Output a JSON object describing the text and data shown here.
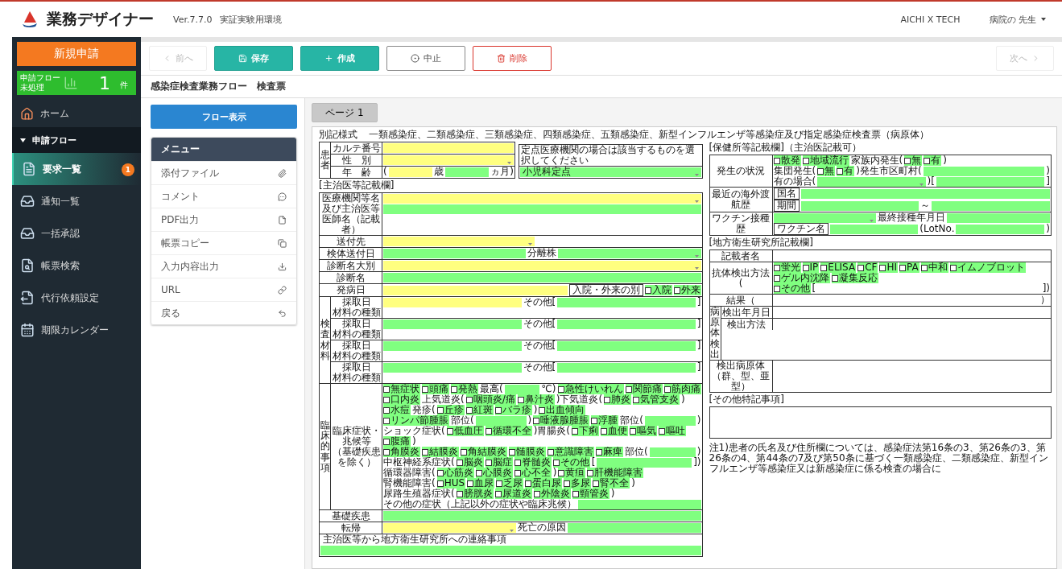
{
  "header": {
    "app_name": "業務デザイナー",
    "version": "Ver.7.7.0",
    "environment": "実証実験用環境",
    "org": "AICHI X TECH",
    "user": "病院の 先生"
  },
  "sidebar": {
    "new_button": "新規申請",
    "flow_panel": {
      "title": "申請フロー",
      "status": "未処理",
      "count": "1",
      "unit": "件"
    },
    "items": [
      {
        "label": "ホーム",
        "selected": false
      }
    ],
    "section": {
      "label": "申請フロー",
      "expanded": true
    },
    "sub_items": [
      {
        "label": "要求一覧",
        "selected": true,
        "badge": "1"
      },
      {
        "label": "通知一覧",
        "selected": false
      },
      {
        "label": "一括承認",
        "selected": false
      },
      {
        "label": "帳票検索",
        "selected": false
      },
      {
        "label": "代行依頼設定",
        "selected": false
      },
      {
        "label": "期限カレンダー",
        "selected": false
      }
    ]
  },
  "toolbar": {
    "prev": {
      "label": "前へ",
      "disabled": true
    },
    "buttons": [
      {
        "kind": "save",
        "label": "保存"
      },
      {
        "kind": "create",
        "label": "作成"
      },
      {
        "kind": "cancel",
        "label": "中止"
      },
      {
        "kind": "delete",
        "label": "削除"
      }
    ],
    "next": {
      "label": "次へ",
      "disabled": true
    }
  },
  "page_title": "感染症検査業務フロー　検査票",
  "flow_button": "フロー表示",
  "menu": {
    "title": "メニュー",
    "items": [
      "添付ファイル",
      "コメント",
      "PDF出力",
      "帳票コピー",
      "入力内容出力",
      "URL",
      "戻る"
    ]
  },
  "tabs": [
    {
      "label": "ページ 1",
      "selected": true
    }
  ],
  "form": {
    "form_no": "別記様式",
    "title": "一類感染症、二類感染症、三類感染症、四類感染症、五類感染症、新型インフルエンザ等感染症及び指定感染症検査票（病原体）",
    "left": [
      {
        "kind": "table",
        "rows": [
          {
            "kind": "group",
            "group": "患者",
            "rows": [
              {
                "kind": "row",
                "label": "カルテ番号",
                "lines": [
                  [
                    {
                      "kind": "field",
                      "required": true,
                      "dropdown": false
                    }
                  ]
                ]
              },
              {
                "kind": "row",
                "label": "性　別",
                "lines": [
                  [
                    {
                      "kind": "field",
                      "required": true,
                      "dropdown": true
                    }
                  ]
                ]
              },
              {
                "kind": "row",
                "label": "年　齢",
                "lines": [
                  [
                    {
                      "kind": "text",
                      "text": "("
                    },
                    {
                      "kind": "field",
                      "required": true,
                      "dropdown": false
                    },
                    {
                      "kind": "text",
                      "text": "歳"
                    },
                    {
                      "kind": "field",
                      "required": false,
                      "dropdown": false
                    },
                    {
                      "kind": "text",
                      "text": "ヵ月)"
                    }
                  ]
                ]
              }
            ]
          }
        ],
        "aside": {
          "text": "定点医療機関の場合は該当するものを選択してください",
          "lines": [
            [
              {
                "kind": "field",
                "required": false,
                "dropdown": true,
                "value": "小児科定点"
              }
            ]
          ]
        }
      },
      {
        "kind": "caption",
        "text": "[主治医等記載欄]"
      },
      {
        "kind": "table",
        "rows": [
          {
            "kind": "row",
            "label": "医療機関等名及び主治医等医師名（記載者）",
            "lines": [
              [
                {
                  "kind": "field",
                  "required": true,
                  "dropdown": true
                }
              ],
              [
                {
                  "kind": "field",
                  "required": false,
                  "dropdown": false
                }
              ]
            ]
          },
          {
            "kind": "row",
            "label": "送付先",
            "lines": [
              [
                {
                  "kind": "field",
                  "required": true,
                  "dropdown": true
                },
                {
                  "kind": "blank"
                }
              ]
            ]
          },
          {
            "kind": "row",
            "label": "検体送付日",
            "lines": [
              [
                {
                  "kind": "field",
                  "required": false,
                  "dropdown": false
                },
                {
                  "kind": "text",
                  "text": "分離株"
                },
                {
                  "kind": "field",
                  "required": false,
                  "dropdown": true
                }
              ]
            ]
          },
          {
            "kind": "row",
            "label": "診断名大別",
            "lines": [
              [
                {
                  "kind": "field",
                  "required": true,
                  "dropdown": true
                }
              ]
            ]
          },
          {
            "kind": "row",
            "label": "診断名",
            "lines": [
              [
                {
                  "kind": "field",
                  "required": false,
                  "dropdown": false
                }
              ]
            ]
          },
          {
            "kind": "row",
            "label": "発病日",
            "lines": [
              [
                {
                  "kind": "field",
                  "required": true,
                  "dropdown": false
                },
                {
                  "kind": "label",
                  "text": "入院・外来の別"
                },
                {
                  "kind": "check",
                  "label": "入院",
                  "checked": false
                },
                {
                  "kind": "check",
                  "label": "外来",
                  "checked": false
                }
              ]
            ]
          },
          {
            "kind": "group",
            "group": "検査材料",
            "rows": [
              {
                "kind": "row",
                "label": "採取日",
                "label_note": "材料の種類",
                "lines": [
                  [
                    {
                      "kind": "field",
                      "required": true,
                      "dropdown": false
                    },
                    {
                      "kind": "text",
                      "text": "その他["
                    },
                    {
                      "kind": "field",
                      "required": false,
                      "dropdown": false
                    },
                    {
                      "kind": "text",
                      "text": "]"
                    }
                  ]
                ]
              },
              {
                "kind": "row",
                "label": "採取日",
                "label_note": "材料の種類",
                "lines": [
                  [
                    {
                      "kind": "field",
                      "required": false,
                      "dropdown": false
                    },
                    {
                      "kind": "text",
                      "text": "その他["
                    },
                    {
                      "kind": "field",
                      "required": false,
                      "dropdown": false
                    },
                    {
                      "kind": "text",
                      "text": "]"
                    }
                  ]
                ]
              },
              {
                "kind": "row",
                "label": "採取日",
                "label_note": "材料の種類",
                "lines": [
                  [
                    {
                      "kind": "field",
                      "required": false,
                      "dropdown": false
                    },
                    {
                      "kind": "text",
                      "text": "その他["
                    },
                    {
                      "kind": "field",
                      "required": false,
                      "dropdown": false
                    },
                    {
                      "kind": "text",
                      "text": "]"
                    }
                  ]
                ]
              },
              {
                "kind": "row",
                "label": "採取日",
                "label_note": "材料の種類",
                "lines": [
                  [
                    {
                      "kind": "field",
                      "required": false,
                      "dropdown": false
                    },
                    {
                      "kind": "text",
                      "text": "その他["
                    },
                    {
                      "kind": "field",
                      "required": false,
                      "dropdown": false
                    },
                    {
                      "kind": "text",
                      "text": "]"
                    }
                  ]
                ]
              }
            ]
          },
          {
            "kind": "group",
            "group": "臨床的事項",
            "rows": [
              {
                "kind": "row",
                "label": "臨床症状・兆候等",
                "label_note": "（基礎疾患を除く）",
                "lines": [
                  [
                    {
                      "kind": "check",
                      "label": "無症状",
                      "checked": false
                    },
                    {
                      "kind": "check",
                      "label": "頭痛",
                      "checked": false
                    },
                    {
                      "kind": "check",
                      "label": "発熱",
                      "checked": false
                    },
                    {
                      "kind": "text",
                      "text": "最高("
                    },
                    {
                      "kind": "field",
                      "required": false,
                      "dropdown": false
                    },
                    {
                      "kind": "text",
                      "text": "℃)"
                    },
                    {
                      "kind": "check",
                      "label": "急性けいれん",
                      "checked": false
                    },
                    {
                      "kind": "check",
                      "label": "関節痛",
                      "checked": false
                    },
                    {
                      "kind": "check",
                      "label": "筋肉痛",
                      "checked": false
                    }
                  ],
                  [
                    {
                      "kind": "check",
                      "label": "口内炎",
                      "checked": false
                    },
                    {
                      "kind": "text",
                      "text": "上気道炎("
                    },
                    {
                      "kind": "check",
                      "label": "咽頭炎/痛",
                      "checked": false
                    },
                    {
                      "kind": "check",
                      "label": "鼻汁炎",
                      "checked": false
                    },
                    {
                      "kind": "text",
                      "text": ")下気道炎("
                    },
                    {
                      "kind": "check",
                      "label": "肺炎",
                      "checked": false
                    },
                    {
                      "kind": "check",
                      "label": "気管支炎",
                      "checked": false
                    },
                    {
                      "kind": "text",
                      "text": ")"
                    }
                  ],
                  [
                    {
                      "kind": "check",
                      "label": "水痘",
                      "checked": false
                    },
                    {
                      "kind": "text",
                      "text": "発疹("
                    },
                    {
                      "kind": "check",
                      "label": "丘疹",
                      "checked": false
                    },
                    {
                      "kind": "check",
                      "label": "紅斑",
                      "checked": false
                    },
                    {
                      "kind": "check",
                      "label": "バラ疹",
                      "checked": false
                    },
                    {
                      "kind": "text",
                      "text": ")"
                    },
                    {
                      "kind": "check",
                      "label": "出血傾向",
                      "checked": false
                    }
                  ],
                  [
                    {
                      "kind": "check",
                      "label": "リンパ節腫脹",
                      "checked": false
                    },
                    {
                      "kind": "text",
                      "text": "部位("
                    },
                    {
                      "kind": "field",
                      "required": false,
                      "dropdown": false
                    },
                    {
                      "kind": "text",
                      "text": ")"
                    },
                    {
                      "kind": "check",
                      "label": "唾液腺腫脹",
                      "checked": false
                    },
                    {
                      "kind": "check",
                      "label": "浮腫",
                      "checked": false
                    },
                    {
                      "kind": "text",
                      "text": "部位("
                    },
                    {
                      "kind": "field",
                      "required": false,
                      "dropdown": false
                    },
                    {
                      "kind": "text",
                      "text": ")"
                    }
                  ],
                  [
                    {
                      "kind": "text",
                      "text": "ショック症状("
                    },
                    {
                      "kind": "check",
                      "label": "低血圧",
                      "checked": false
                    },
                    {
                      "kind": "check",
                      "label": "循環不全",
                      "checked": false
                    },
                    {
                      "kind": "text",
                      "text": ")胃腸炎("
                    },
                    {
                      "kind": "check",
                      "label": "下痢",
                      "checked": false
                    },
                    {
                      "kind": "check",
                      "label": "血便",
                      "checked": false
                    },
                    {
                      "kind": "check",
                      "label": "嘔気",
                      "checked": false
                    },
                    {
                      "kind": "check",
                      "label": "嘔吐",
                      "checked": false
                    },
                    {
                      "kind": "check",
                      "label": "腹痛",
                      "checked": false
                    },
                    {
                      "kind": "text",
                      "text": ")"
                    }
                  ],
                  [
                    {
                      "kind": "check",
                      "label": "角膜炎",
                      "checked": false
                    },
                    {
                      "kind": "check",
                      "label": "結膜炎",
                      "checked": false
                    },
                    {
                      "kind": "check",
                      "label": "角結膜炎",
                      "checked": false
                    },
                    {
                      "kind": "check",
                      "label": "髄膜炎",
                      "checked": false
                    },
                    {
                      "kind": "check",
                      "label": "意識障害",
                      "checked": false
                    },
                    {
                      "kind": "check",
                      "label": "麻痺",
                      "checked": false
                    },
                    {
                      "kind": "text",
                      "text": "部位("
                    },
                    {
                      "kind": "field",
                      "required": false,
                      "dropdown": false
                    },
                    {
                      "kind": "text",
                      "text": ")"
                    }
                  ],
                  [
                    {
                      "kind": "text",
                      "text": "中枢神経系症状("
                    },
                    {
                      "kind": "check",
                      "label": "脳炎",
                      "checked": false
                    },
                    {
                      "kind": "check",
                      "label": "脳症",
                      "checked": false
                    },
                    {
                      "kind": "check",
                      "label": "脊髄炎",
                      "checked": false
                    },
                    {
                      "kind": "check",
                      "label": "その他",
                      "checked": false
                    },
                    {
                      "kind": "text",
                      "text": "["
                    },
                    {
                      "kind": "field",
                      "required": false,
                      "dropdown": false
                    },
                    {
                      "kind": "text",
                      "text": "])"
                    }
                  ],
                  [
                    {
                      "kind": "text",
                      "text": "循環器障害("
                    },
                    {
                      "kind": "check",
                      "label": "心筋炎",
                      "checked": false
                    },
                    {
                      "kind": "check",
                      "label": "心膜炎",
                      "checked": false
                    },
                    {
                      "kind": "check",
                      "label": "心不全",
                      "checked": false
                    },
                    {
                      "kind": "text",
                      "text": ")"
                    },
                    {
                      "kind": "check",
                      "label": "黄疸",
                      "checked": false
                    },
                    {
                      "kind": "check",
                      "label": "肝機能障害",
                      "checked": false
                    }
                  ],
                  [
                    {
                      "kind": "text",
                      "text": "腎機能障害("
                    },
                    {
                      "kind": "check",
                      "label": "HUS",
                      "checked": false
                    },
                    {
                      "kind": "check",
                      "label": "血尿",
                      "checked": false
                    },
                    {
                      "kind": "check",
                      "label": "乏尿",
                      "checked": false
                    },
                    {
                      "kind": "check",
                      "label": "蛋白尿",
                      "checked": false
                    },
                    {
                      "kind": "check",
                      "label": "多尿",
                      "checked": false
                    },
                    {
                      "kind": "check",
                      "label": "腎不全",
                      "checked": false
                    },
                    {
                      "kind": "text",
                      "text": ")"
                    }
                  ],
                  [
                    {
                      "kind": "text",
                      "text": "尿路生殖器症状("
                    },
                    {
                      "kind": "check",
                      "label": "膀胱炎",
                      "checked": false
                    },
                    {
                      "kind": "check",
                      "label": "尿道炎",
                      "checked": false
                    },
                    {
                      "kind": "check",
                      "label": "外陰炎",
                      "checked": false
                    },
                    {
                      "kind": "check",
                      "label": "頸管炎",
                      "checked": false
                    },
                    {
                      "kind": "text",
                      "text": ")"
                    }
                  ],
                  [
                    {
                      "kind": "text",
                      "text": "その他の症状（上記以外の症状や臨床兆候）"
                    },
                    {
                      "kind": "field",
                      "required": false,
                      "dropdown": false
                    }
                  ]
                ]
              }
            ]
          },
          {
            "kind": "row",
            "label": "基礎疾患",
            "lines": [
              [
                {
                  "kind": "field",
                  "required": false,
                  "dropdown": false
                }
              ]
            ]
          },
          {
            "kind": "row",
            "label": "転帰",
            "lines": [
              [
                {
                  "kind": "field",
                  "required": true,
                  "dropdown": true
                },
                {
                  "kind": "text",
                  "text": "死亡の原因"
                },
                {
                  "kind": "field",
                  "required": false,
                  "dropdown": false
                }
              ]
            ]
          },
          {
            "kind": "stacked",
            "label": "主治医等から地方衛生研究所への連絡事項",
            "lines": [
              [
                {
                  "kind": "field",
                  "required": false,
                  "dropdown": false
                }
              ]
            ]
          }
        ]
      }
    ],
    "right": [
      {
        "kind": "caption",
        "text": "[保健所等記載欄]（主治医記載可）"
      },
      {
        "kind": "table",
        "rows": [
          {
            "kind": "row",
            "label": "発生の状況",
            "lines": [
              [
                {
                  "kind": "check",
                  "label": "散発",
                  "checked": false
                },
                {
                  "kind": "check",
                  "label": "地域流行",
                  "checked": false
                },
                {
                  "kind": "text",
                  "text": "家族内発生("
                },
                {
                  "kind": "check",
                  "label": "無",
                  "checked": false
                },
                {
                  "kind": "check",
                  "label": "有",
                  "checked": false
                },
                {
                  "kind": "text",
                  "text": ")"
                }
              ],
              [
                {
                  "kind": "text",
                  "text": "集団発生("
                },
                {
                  "kind": "check",
                  "label": "無",
                  "checked": false
                },
                {
                  "kind": "check",
                  "label": "有",
                  "checked": false
                },
                {
                  "kind": "text",
                  "text": ")発生市区町村("
                },
                {
                  "kind": "field",
                  "required": false,
                  "dropdown": false
                },
                {
                  "kind": "text",
                  "text": ")"
                }
              ],
              [
                {
                  "kind": "text",
                  "text": "有の場合("
                },
                {
                  "kind": "field",
                  "required": false,
                  "dropdown": true
                },
                {
                  "kind": "text",
                  "text": ")["
                },
                {
                  "kind": "field",
                  "required": false,
                  "dropdown": false
                },
                {
                  "kind": "text",
                  "text": "]"
                }
              ]
            ]
          },
          {
            "kind": "row",
            "label": "最近の海外渡航歴",
            "lines": [
              [
                {
                  "kind": "label",
                  "text": "国名"
                },
                {
                  "kind": "field",
                  "required": false,
                  "dropdown": false
                }
              ],
              [
                {
                  "kind": "label",
                  "text": "期間"
                },
                {
                  "kind": "field",
                  "required": false,
                  "dropdown": false
                },
                {
                  "kind": "text",
                  "text": "～"
                },
                {
                  "kind": "field",
                  "required": false,
                  "dropdown": false
                }
              ]
            ]
          },
          {
            "kind": "row",
            "label": "ワクチン接種歴",
            "lines": [
              [
                {
                  "kind": "field",
                  "required": false,
                  "dropdown": true
                },
                {
                  "kind": "text",
                  "text": "最終接種年月日"
                },
                {
                  "kind": "field",
                  "required": false,
                  "dropdown": false
                }
              ],
              [
                {
                  "kind": "label",
                  "text": "ワクチン名"
                },
                {
                  "kind": "field",
                  "required": false,
                  "dropdown": false
                },
                {
                  "kind": "text",
                  "text": "(LotNo."
                },
                {
                  "kind": "field",
                  "required": false,
                  "dropdown": false
                },
                {
                  "kind": "text",
                  "text": ")"
                }
              ]
            ]
          }
        ]
      },
      {
        "kind": "caption",
        "text": "[地方衛生研究所記載欄]"
      },
      {
        "kind": "table",
        "rows": [
          {
            "kind": "row",
            "label": "記載者名",
            "lines": []
          },
          {
            "kind": "row",
            "label": "抗体検出方法(",
            "lines": [
              [
                {
                  "kind": "check",
                  "label": "蛍光",
                  "checked": false
                },
                {
                  "kind": "check",
                  "label": "IP",
                  "checked": false
                },
                {
                  "kind": "check",
                  "label": "ELISA",
                  "checked": false
                },
                {
                  "kind": "check",
                  "label": "CF",
                  "checked": false
                },
                {
                  "kind": "check",
                  "label": "HI",
                  "checked": false
                },
                {
                  "kind": "check",
                  "label": "PA",
                  "checked": false
                },
                {
                  "kind": "check",
                  "label": "中和",
                  "checked": false
                },
                {
                  "kind": "check",
                  "label": "イムノブロット",
                  "checked": false
                }
              ],
              [
                {
                  "kind": "check",
                  "label": "ゲル内沈降",
                  "checked": false
                },
                {
                  "kind": "check",
                  "label": "凝集反応",
                  "checked": false
                }
              ],
              [
                {
                  "kind": "check",
                  "label": "その他",
                  "checked": false
                },
                {
                  "kind": "text",
                  "text": "["
                },
                {
                  "kind": "blank"
                },
                {
                  "kind": "text",
                  "text": "])"
                }
              ]
            ]
          },
          {
            "kind": "row",
            "label": "結果（",
            "lines": [
              [
                {
                  "kind": "blank"
                },
                {
                  "kind": "text",
                  "text": "）"
                }
              ]
            ]
          },
          {
            "kind": "group",
            "group": "病原体検出",
            "rows": [
              {
                "kind": "row",
                "label": "検出年月日",
                "lines": []
              },
              {
                "kind": "row",
                "label": "検出方法",
                "lines": []
              }
            ]
          },
          {
            "kind": "row",
            "label": "検出病原体（群、型、亜型）",
            "lines": []
          }
        ]
      },
      {
        "kind": "caption",
        "text": "[その他特記事項]"
      },
      {
        "kind": "box"
      },
      {
        "kind": "note",
        "text": "注1)患者の氏名及び住所欄については、感染症法第16条の3、第26条の3、第26条の4、第44条の7及び第50条に基づく一類感染症、二類感染症、新型インフルエンザ等感染症又は新感染症に係る検査の場合に"
      }
    ]
  }
}
